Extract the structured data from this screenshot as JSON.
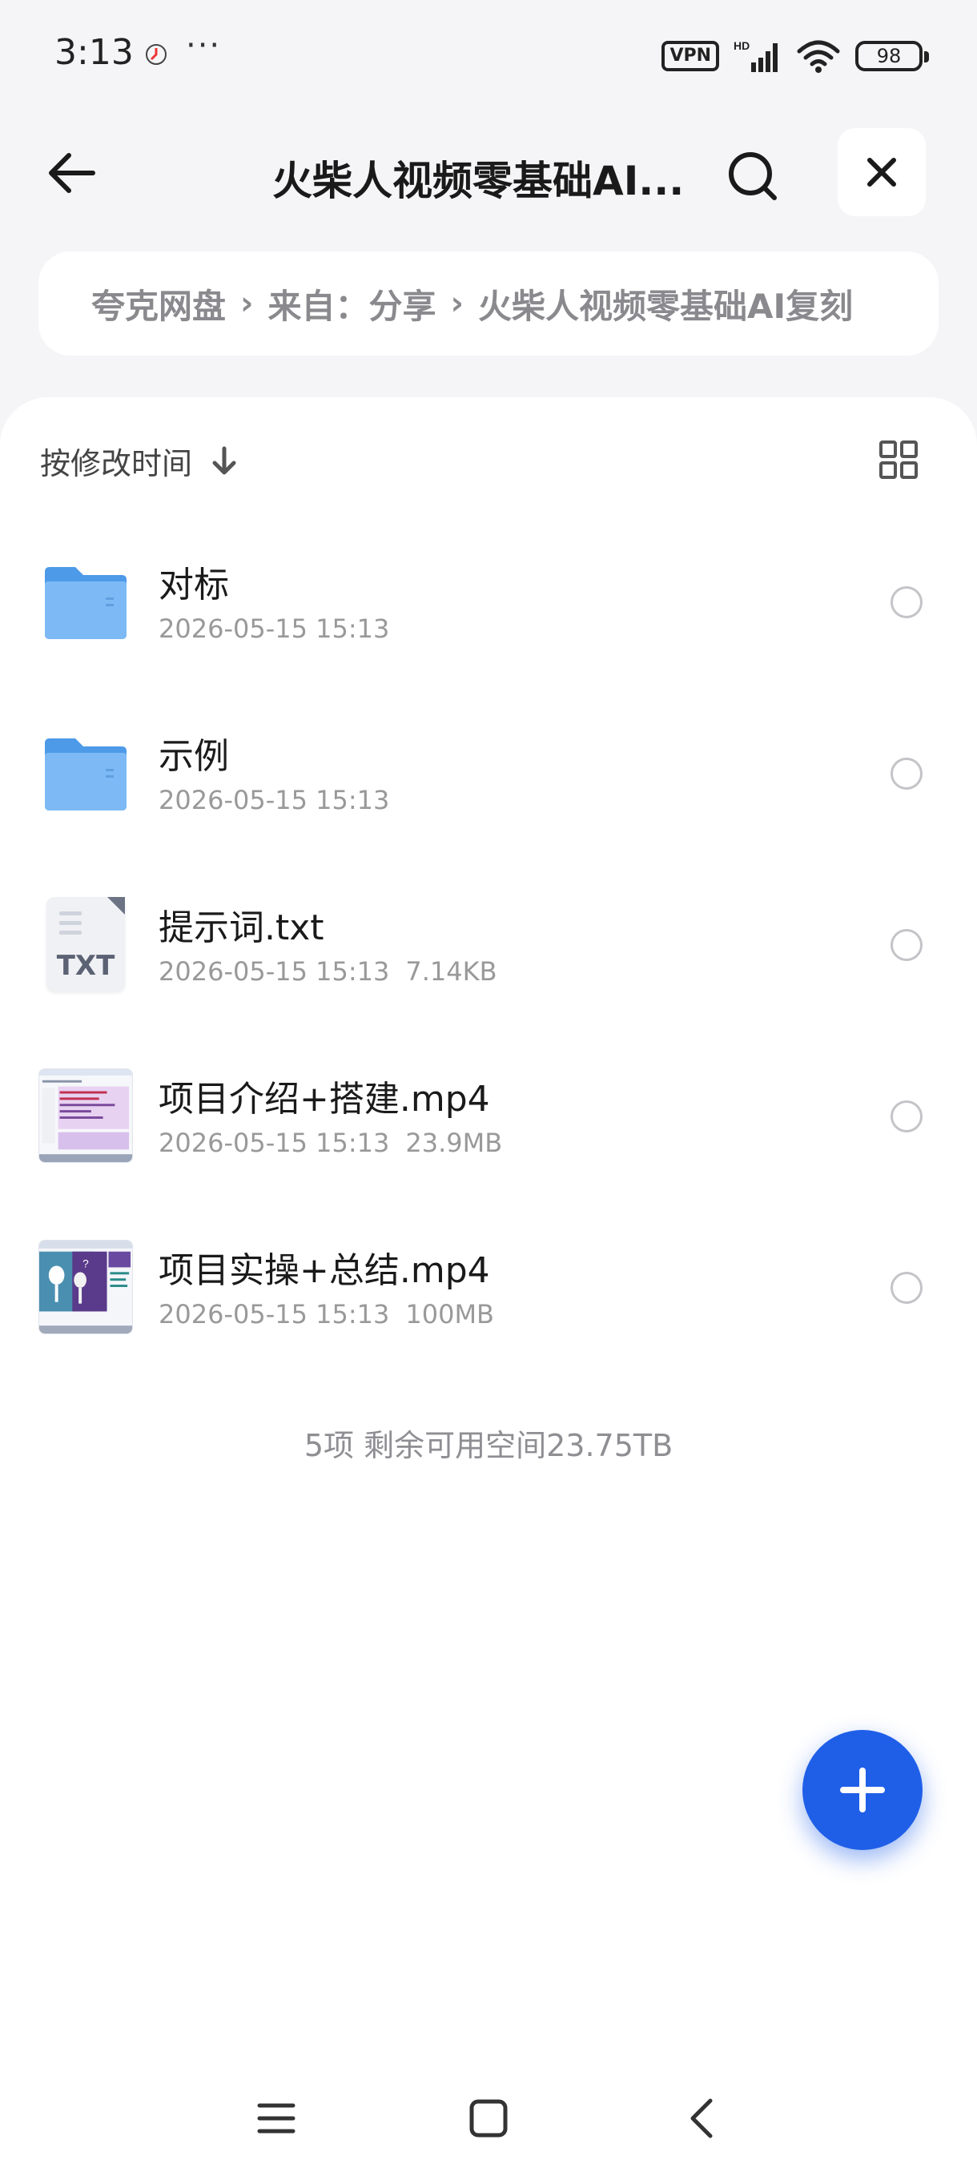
{
  "status_bar": {
    "time": "3:13",
    "dots": "···",
    "vpn": "VPN",
    "hd": "HD",
    "battery": "98"
  },
  "header": {
    "title": "火柴人视频零基础AI..."
  },
  "breadcrumb": {
    "items": [
      "夸克网盘",
      "来自：分享",
      "火柴人视频零基础AI复刻"
    ]
  },
  "sort": {
    "label": "按修改时间"
  },
  "files": [
    {
      "name": "对标",
      "date": "2026-05-15 15:13",
      "size": "",
      "type": "folder"
    },
    {
      "name": "示例",
      "date": "2026-05-15 15:13",
      "size": "",
      "type": "folder"
    },
    {
      "name": "提示词.txt",
      "date": "2026-05-15 15:13",
      "size": "7.14KB",
      "type": "txt"
    },
    {
      "name": "项目介绍+搭建.mp4",
      "date": "2026-05-15 15:13",
      "size": "23.9MB",
      "type": "video"
    },
    {
      "name": "项目实操+总结.mp4",
      "date": "2026-05-15 15:13",
      "size": "100MB",
      "type": "video"
    }
  ],
  "txt_icon_label": "TXT",
  "summary": "5项 剩余可用空间23.75TB",
  "colors": {
    "accent": "#1f5fe8",
    "folder": "#5aa8f0",
    "background": "#f5f5f7"
  },
  "icons": [
    "back-arrow-icon",
    "search-icon",
    "close-icon",
    "sort-down-icon",
    "grid-view-icon",
    "plus-icon",
    "menu-icon",
    "home-icon",
    "back-chevron-icon"
  ]
}
